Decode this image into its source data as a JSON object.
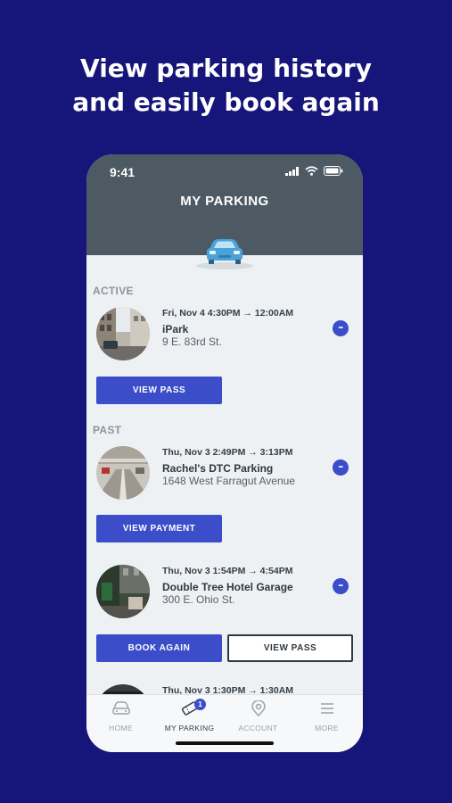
{
  "headline": {
    "line1": "View parking history",
    "line2": "and easily book again"
  },
  "status_bar": {
    "time": "9:41"
  },
  "header": {
    "title": "MY PARKING"
  },
  "sections": {
    "active": "ACTIVE",
    "past": "PAST"
  },
  "entries": [
    {
      "time": "Fri, Nov 4 4:30PM → 12:00AM",
      "name": "iPark",
      "address": "9 E. 83rd St.",
      "actions": [
        "VIEW PASS"
      ]
    },
    {
      "time": "Thu, Nov 3 2:49PM → 3:13PM",
      "name": "Rachel's DTC Parking",
      "address": "1648 West Farragut Avenue",
      "actions": [
        "VIEW PAYMENT"
      ]
    },
    {
      "time": "Thu, Nov 3 1:54PM → 4:54PM",
      "name": "Double Tree Hotel Garage",
      "address": "300 E. Ohio St.",
      "actions": [
        "BOOK AGAIN",
        "VIEW PASS"
      ]
    },
    {
      "time": "Thu, Nov 3 1:30PM → 1:30AM"
    }
  ],
  "more_glyph": "•••",
  "tabbar": {
    "tabs": [
      {
        "label": "HOME",
        "icon": "car-icon"
      },
      {
        "label": "MY PARKING",
        "icon": "ticket-icon",
        "badge": "1",
        "active": true
      },
      {
        "label": "ACCOUNT",
        "icon": "location-pin-icon"
      },
      {
        "label": "MORE",
        "icon": "menu-icon"
      }
    ]
  },
  "colors": {
    "background": "#16157a",
    "accent": "#3b4dc8",
    "header": "#4d5a63"
  }
}
